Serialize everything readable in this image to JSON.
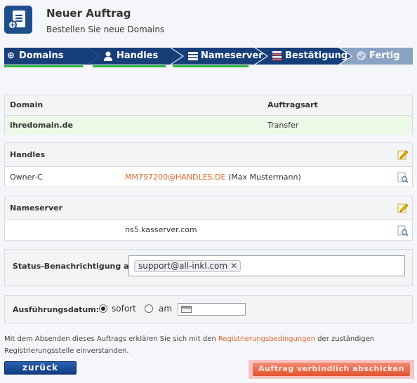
{
  "header": {
    "title": "Neuer Auftrag",
    "subtitle": "Bestellen Sie neue Domains"
  },
  "steps": [
    {
      "label": "Domains",
      "icon": "plus-circle-icon",
      "state": "done"
    },
    {
      "label": "Handles",
      "icon": "user-icon",
      "state": "done"
    },
    {
      "label": "Nameserver",
      "icon": "server-icon",
      "state": "done"
    },
    {
      "label": "Bestätigung",
      "icon": "list-icon",
      "state": "current"
    },
    {
      "label": "Fertig",
      "icon": "check-icon",
      "state": "pending"
    }
  ],
  "domain_table": {
    "col_domain": "Domain",
    "col_type": "Auftragsart",
    "row_domain": "ihredomain.de",
    "row_type": "Transfer"
  },
  "handles": {
    "heading": "Handles",
    "role": "Owner-C",
    "handle": "MM797200@HANDLES.DE",
    "name": "(Max Mustermann)"
  },
  "nameserver": {
    "heading": "Nameserver",
    "value": "ns5.kasserver.com"
  },
  "status": {
    "label": "Status-Benachrichtigung an:",
    "tag": "support@all-inkl.com",
    "remove_symbol": "✕"
  },
  "execution": {
    "label": "Ausführungsdatum:",
    "option_now": "sofort",
    "option_at": "am",
    "selected": "sofort"
  },
  "note": {
    "before": "Mit dem Absenden dieses Auftrags erklären Sie sich mit den ",
    "link": "Registrierungsbedingungen",
    "after": " der zuständigen Registrierungsstelle einverstanden."
  },
  "buttons": {
    "back": "zurück",
    "submit": "Auftrag verbindlich abschicken"
  },
  "colors": {
    "nav_dark": "#163f7a",
    "nav_pending": "#8aa3c2",
    "progress": "#2db33c",
    "link": "#e0662a",
    "domain_row_bg": "#ecf9e7",
    "submit": "#e2542f"
  }
}
